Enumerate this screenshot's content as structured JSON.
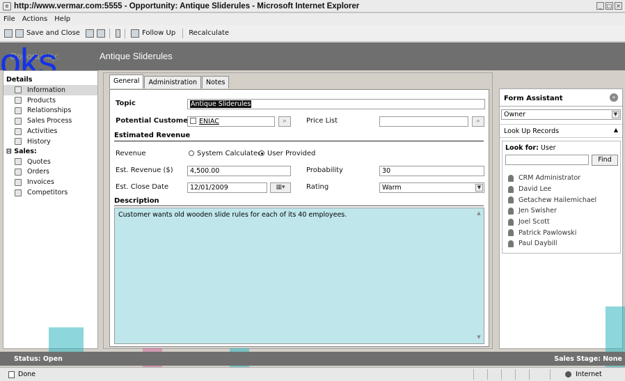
{
  "window": {
    "title": "http://www.vermar.com:5555 - Opportunity: Antique Sliderules - Microsoft Internet Explorer"
  },
  "menu": {
    "file": "File",
    "actions": "Actions",
    "help": "Help"
  },
  "toolbar": {
    "save_and_close": "Save and Close",
    "follow_up": "Follow Up",
    "recalculate": "Recalculate"
  },
  "header": {
    "page_title": "Antique Sliderules",
    "title_fragment": "Opportunity:",
    "watermark_text": "oks"
  },
  "leftnav": {
    "details_label": "Details",
    "details_items": [
      "Information",
      "Products",
      "Relationships",
      "Sales Process",
      "Activities",
      "History"
    ],
    "sales_label": "Sales:",
    "sales_items": [
      "Quotes",
      "Orders",
      "Invoices",
      "Competitors"
    ]
  },
  "tabs": [
    "General",
    "Administration",
    "Notes"
  ],
  "form": {
    "topic_label": "Topic",
    "topic_value": "Antique Sliderules",
    "potential_customer_label": "Potential Customer",
    "potential_customer_value": "ENIAC",
    "price_list_label": "Price List",
    "price_list_value": "",
    "estimated_revenue_section": "Estimated Revenue",
    "revenue_label": "Revenue",
    "revenue_option_system": "System Calculated",
    "revenue_option_user": "User Provided",
    "revenue_selected": "User Provided",
    "est_revenue_label": "Est. Revenue ($)",
    "est_revenue_value": "4,500.00",
    "probability_label": "Probability",
    "probability_value": "30",
    "est_close_date_label": "Est. Close Date",
    "est_close_date_value": "12/01/2009",
    "rating_label": "Rating",
    "rating_value": "Warm",
    "description_section": "Description",
    "description_value": "Customer wants old wooden slide rules for each of its 40 employees."
  },
  "assistant": {
    "title": "Form Assistant",
    "selected_field": "Owner",
    "lookup_records": "Look Up Records",
    "look_for_label": "Look for:",
    "look_for_value": "User",
    "search_value": "",
    "find_button": "Find",
    "users": [
      "CRM Administrator",
      "David Lee",
      "Getachew Hailemichael",
      "Jen Swisher",
      "Joel Scott",
      "Patrick Pawlowski",
      "Paul Daybill"
    ]
  },
  "status": {
    "left": "Status: Open",
    "right": "Sales Stage: None"
  },
  "browser_status": {
    "done": "Done",
    "zone": "Internet"
  },
  "colors": {
    "header_band": "#6f6f6f",
    "watermark_blue": "#1433e6",
    "overlay_teal": "#2fb7c0",
    "overlay_pink": "#d0318a"
  }
}
